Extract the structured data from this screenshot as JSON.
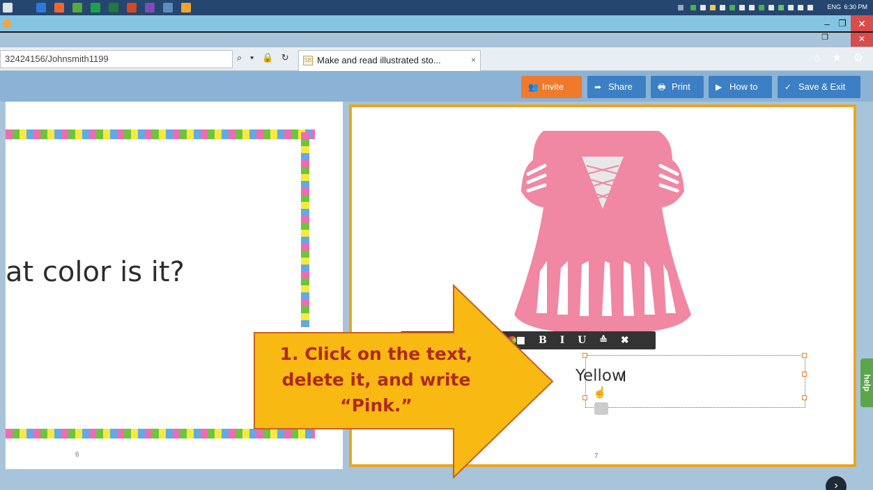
{
  "taskbar": {
    "app_colors": [
      "#f06633",
      "#2f79d9",
      "#58a83d",
      "#1ea14a",
      "#1e7a3f",
      "#d24726",
      "#7f4bb6",
      "#f0a42e"
    ],
    "lang": "ENG",
    "time": "6:30 PM"
  },
  "window": {
    "min": "–",
    "max": "❐",
    "close": "✕",
    "ghost_close": "✕"
  },
  "browser": {
    "url": "32424156/Johnsmith1199",
    "address_icons": "⌕ ▾ 🔒 ↻",
    "tab_title": "Make and read illustrated sto...",
    "tab_close": "×",
    "right_icons": "⌂ ★ ⚙"
  },
  "toolbar": {
    "invite": "Invite",
    "share": "Share",
    "print": "Print",
    "howto": "How to",
    "save_exit": "Save & Exit",
    "icons": {
      "invite": "people-icon",
      "share": "share-icon",
      "print": "print-icon",
      "howto": "video-icon",
      "save": "check-circle-icon"
    }
  },
  "page_left": {
    "text": "at color is it?",
    "number": "6"
  },
  "page_right": {
    "number": "7",
    "dress_color": "#f087a3",
    "frame_color": "#e9a623"
  },
  "text_toolbar": {
    "tools": "▾ ■ B I U ≙ ✖"
  },
  "textbox": {
    "text": "Yellow",
    "ibeam": "I",
    "move_handle": "☝"
  },
  "callout": {
    "line1": "1. Click on the text,",
    "line2": "delete it, and write",
    "line3": "“Pink.”",
    "fill": "#f8b912",
    "text_color": "#b02a1a"
  },
  "help": "help",
  "next": "›"
}
